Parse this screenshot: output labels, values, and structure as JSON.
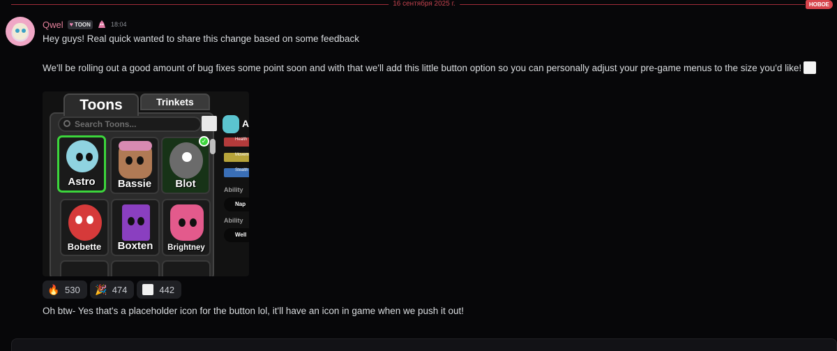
{
  "divider": {
    "date": "16 сентября 2025 г.",
    "new_label": "НОВОЕ"
  },
  "message": {
    "author": "Qwel",
    "tag": "TOON",
    "timestamp": "18:04",
    "line1": "Hey guys! Real quick wanted to share this change based on some feedback",
    "line2": "We'll be rolling out a good amount of bug fixes some point soon and with that we'll add this little button option so you can personally adjust your pre-game menus to the size you'd like!",
    "line3": "Oh btw- Yes that's a placeholder icon for the button lol, it'll have an icon in game when we push it out!"
  },
  "screenshot": {
    "tabs": [
      "Toons",
      "Trinkets"
    ],
    "search_placeholder": "Search Toons...",
    "toons": [
      "Astro",
      "Bassie",
      "Blot",
      "Bobette",
      "Boxten",
      "Brightney"
    ],
    "side_letter": "A",
    "stats": [
      "Health",
      "Movement",
      "Stealth"
    ],
    "ability_label": "Ability",
    "abilities": [
      "Nap",
      "Well"
    ]
  },
  "reactions": [
    {
      "emoji": "fire-emoji",
      "count": "530"
    },
    {
      "emoji": "party-popper-emoji",
      "count": "474"
    },
    {
      "emoji": "custom-sticker-emoji",
      "count": "442"
    }
  ],
  "colors": {
    "username": "#e4819b",
    "divider": "#a12d3a",
    "new_badge": "#d7444c",
    "selected_card": "#3cd63c"
  }
}
